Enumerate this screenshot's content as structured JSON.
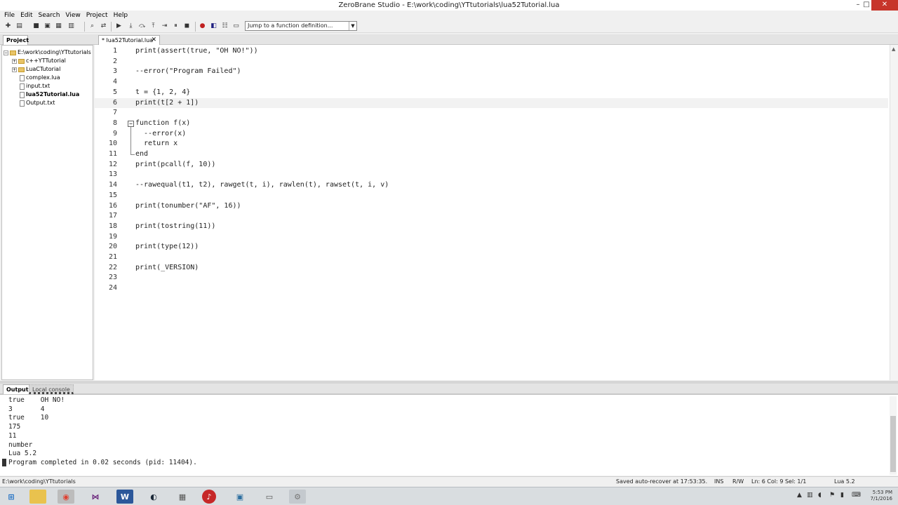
{
  "window": {
    "title": "ZeroBrane Studio - E:\\work\\coding\\YTtutorials\\lua52Tutorial.lua",
    "controls": [
      "–",
      "□",
      "✕"
    ]
  },
  "menu": [
    "File",
    "Edit",
    "Search",
    "View",
    "Project",
    "Help"
  ],
  "toolbar": {
    "function_select_placeholder": "Jump to a function definition..."
  },
  "panels": {
    "project_tab": "Project",
    "editor_tab": "* lua52Tutorial.lua",
    "editor_tab_close": "✕"
  },
  "project_tree": [
    {
      "label": "E:\\work\\coding\\YTtutorials",
      "kind": "root"
    },
    {
      "label": "c++YTTutorial",
      "kind": "folder"
    },
    {
      "label": "LuaCTutorial",
      "kind": "folder"
    },
    {
      "label": "complex.lua",
      "kind": "file"
    },
    {
      "label": "input.txt",
      "kind": "file"
    },
    {
      "label": "lua52Tutorial.lua",
      "kind": "file",
      "active": true
    },
    {
      "label": "Output.txt",
      "kind": "file"
    }
  ],
  "editor": {
    "current_line": 6,
    "lines": [
      {
        "n": "1",
        "text": "print(assert(true, \"OH NO!\"))"
      },
      {
        "n": "2",
        "text": ""
      },
      {
        "n": "3",
        "text": "--error(\"Program Failed\")"
      },
      {
        "n": "4",
        "text": ""
      },
      {
        "n": "5",
        "text": "t = {1, 2, 4}"
      },
      {
        "n": "6",
        "text": "print(t[2 + 1])"
      },
      {
        "n": "7",
        "text": ""
      },
      {
        "n": "8",
        "text": "function f(x)"
      },
      {
        "n": "9",
        "text": "  --error(x)"
      },
      {
        "n": "10",
        "text": "  return x"
      },
      {
        "n": "11",
        "text": "end"
      },
      {
        "n": "12",
        "text": "print(pcall(f, 10))"
      },
      {
        "n": "13",
        "text": ""
      },
      {
        "n": "14",
        "text": "--rawequal(t1, t2), rawget(t, i), rawlen(t), rawset(t, i, v)"
      },
      {
        "n": "15",
        "text": ""
      },
      {
        "n": "16",
        "text": "print(tonumber(\"AF\", 16))"
      },
      {
        "n": "17",
        "text": ""
      },
      {
        "n": "18",
        "text": "print(tostring(11))"
      },
      {
        "n": "19",
        "text": ""
      },
      {
        "n": "20",
        "text": "print(type(12))"
      },
      {
        "n": "21",
        "text": ""
      },
      {
        "n": "22",
        "text": "print(_VERSION)"
      },
      {
        "n": "23",
        "text": ""
      },
      {
        "n": "24",
        "text": ""
      }
    ]
  },
  "output": {
    "tabs": [
      "Output",
      "Local console"
    ],
    "lines": [
      "true    OH NO!",
      "3       4",
      "true    10",
      "175",
      "11",
      "number",
      "Lua 5.2",
      "Program completed in 0.02 seconds (pid: 11404)."
    ]
  },
  "status": {
    "path": "E:\\work\\coding\\YTtutorials",
    "autosave": "Saved auto-recover at 17:53:35.",
    "mode": "INS",
    "rw": "R/W",
    "position": "Ln: 6 Col: 9 Sel: 1/1",
    "interpreter": "Lua 5.2"
  },
  "taskbar": {
    "time": "5:53 PM",
    "date": "7/1/2016"
  }
}
